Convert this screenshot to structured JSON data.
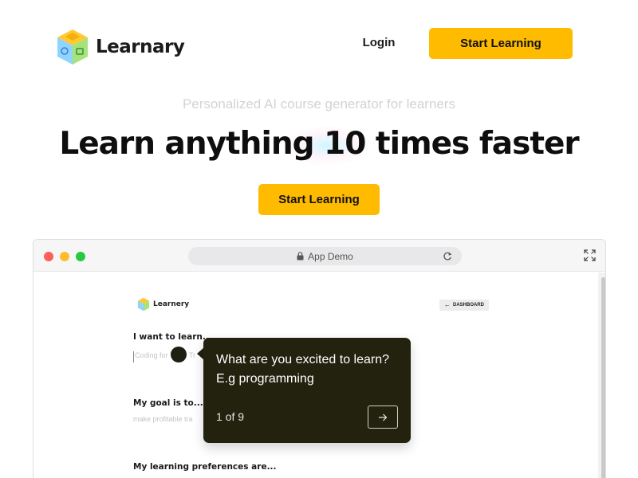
{
  "header": {
    "brand": "Learnary",
    "login_label": "Login",
    "cta_label": "Start Learning",
    "logo_icon": "cube-logo-icon"
  },
  "hero": {
    "tagline": "Personalized AI course generator for learners",
    "headline": "Learn anything 10 times faster",
    "cta_label": "Start Learning"
  },
  "demo_window": {
    "address_label": "App Demo",
    "icons": [
      "lock-icon",
      "reload-icon",
      "expand-icon"
    ],
    "app": {
      "brand": "Learnery",
      "dashboard_label": "DASHBOARD",
      "questions": [
        {
          "label": "I want to learn...",
          "placeholder": "Coding for Tinny Tr"
        },
        {
          "label": "My goal is to...",
          "placeholder": "make profitable tra"
        },
        {
          "label": "My learning preferences are..."
        }
      ]
    }
  },
  "tour_tooltip": {
    "text": "What are you excited to learn? E.g programming",
    "step": "1 of 9",
    "next_icon": "arrow-right-icon"
  },
  "colors": {
    "accent": "#ffbb00",
    "tooltip_bg": "#22220f",
    "traffic_red": "#fe5f57",
    "traffic_yellow": "#febc2e",
    "traffic_green": "#28c840"
  }
}
